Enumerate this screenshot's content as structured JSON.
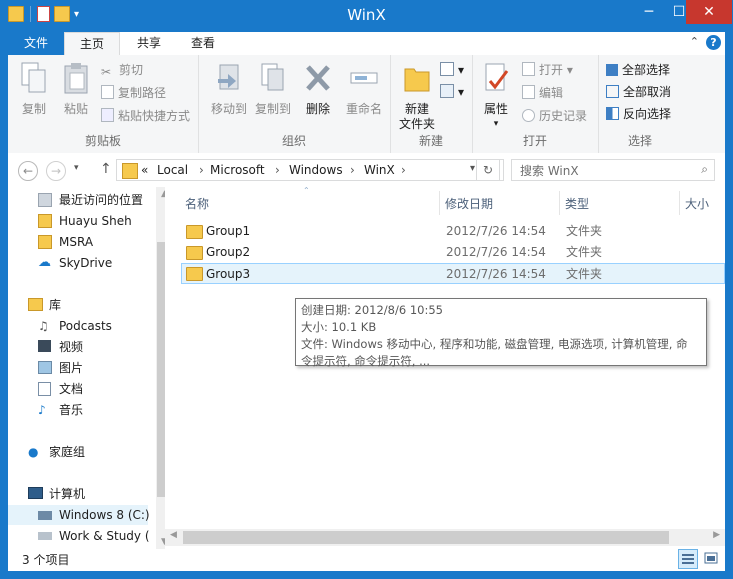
{
  "window": {
    "title": "WinX"
  },
  "tabs": {
    "file": "文件",
    "home": "主页",
    "share": "共享",
    "view": "查看"
  },
  "ribbon": {
    "clipboard": {
      "copy": "复制",
      "paste": "粘贴",
      "cut": "剪切",
      "copy_path": "复制路径",
      "paste_shortcut": "粘贴快捷方式",
      "label": "剪贴板"
    },
    "organize": {
      "move_to": "移动到",
      "copy_to": "复制到",
      "delete": "删除",
      "rename": "重命名",
      "label": "组织"
    },
    "new": {
      "new_folder_1": "新建",
      "new_folder_2": "文件夹",
      "label": "新建"
    },
    "open": {
      "properties": "属性",
      "open": "打开",
      "edit": "编辑",
      "history": "历史记录",
      "label": "打开"
    },
    "select": {
      "select_all": "全部选择",
      "select_none": "全部取消",
      "invert": "反向选择",
      "label": "选择"
    }
  },
  "address": {
    "overflow": "«",
    "crumbs": [
      "Local",
      "Microsoft",
      "Windows",
      "WinX"
    ],
    "search_placeholder": "搜索 WinX"
  },
  "nav": {
    "items": [
      {
        "label": "最近访问的位置",
        "icon": "recent-places-icon"
      },
      {
        "label": "Huayu Sheh",
        "icon": "folder-icon"
      },
      {
        "label": "MSRA",
        "icon": "folder-icon"
      },
      {
        "label": "SkyDrive",
        "icon": "skydrive-cloud-icon"
      },
      {
        "label": "库",
        "icon": "libraries-icon"
      },
      {
        "label": "Podcasts",
        "icon": "podcasts-icon"
      },
      {
        "label": "视频",
        "icon": "video-icon"
      },
      {
        "label": "图片",
        "icon": "pictures-icon"
      },
      {
        "label": "文档",
        "icon": "documents-icon"
      },
      {
        "label": "音乐",
        "icon": "music-icon"
      },
      {
        "label": "家庭组",
        "icon": "homegroup-icon"
      },
      {
        "label": "计算机",
        "icon": "computer-icon"
      },
      {
        "label": "Windows 8 (C:)",
        "icon": "drive-icon"
      },
      {
        "label": "Work & Study (",
        "icon": "drive-icon"
      }
    ]
  },
  "columns": {
    "name": "名称",
    "date": "修改日期",
    "type": "类型",
    "size": "大小"
  },
  "files": [
    {
      "name": "Group1",
      "date": "2012/7/26 14:54",
      "type": "文件夹"
    },
    {
      "name": "Group2",
      "date": "2012/7/26 14:54",
      "type": "文件夹"
    },
    {
      "name": "Group3",
      "date": "2012/7/26 14:54",
      "type": "文件夹"
    }
  ],
  "tooltip": {
    "line1": "创建日期: 2012/8/6 10:55",
    "line2": "大小: 10.1 KB",
    "line3": "文件: Windows 移动中心, 程序和功能, 磁盘管理, 电源选项, 计算机管理, 命",
    "line4": "令提示符, 命令提示符, ..."
  },
  "status": {
    "count": "3 个项目"
  },
  "colors": {
    "accent": "#1979ca",
    "close": "#c7372e",
    "selection": "#e5f3fb"
  }
}
